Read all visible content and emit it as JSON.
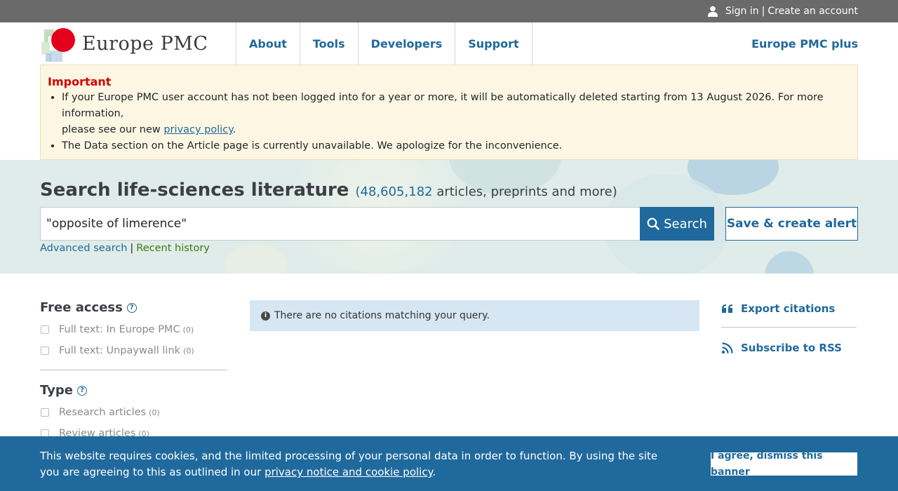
{
  "topbar": {
    "sign_in": "Sign in",
    "separator": "|",
    "create_account": "Create an account"
  },
  "header": {
    "logo_text": "Europe PMC",
    "nav": [
      {
        "label": "About"
      },
      {
        "label": "Tools"
      },
      {
        "label": "Developers"
      },
      {
        "label": "Support"
      }
    ],
    "plus_link": "Europe PMC plus"
  },
  "notice": {
    "heading": "Important",
    "item1_line1": "If your Europe PMC user account has not been logged into for a year or more, it will be automatically deleted starting from 13 August 2026. For more information,",
    "item1_prefix": "please see our new ",
    "item1_link": "privacy policy",
    "item1_suffix": ".",
    "item2": "The Data section on the Article page is currently unavailable. We apologize for the inconvenience."
  },
  "search": {
    "title": "Search life-sciences literature",
    "open_paren": "(",
    "count": "48,605,182",
    "count_suffix": " articles, preprints and more)",
    "query": "\"opposite of limerence\"",
    "button": "Search",
    "alert_button": "Save & create alert",
    "advanced": "Advanced search",
    "sep": "|",
    "history": "Recent history"
  },
  "sidebar": {
    "free_access": {
      "title": "Free access",
      "items": [
        {
          "label": "Full text: In Europe PMC",
          "count": "(0)"
        },
        {
          "label": "Full text: Unpaywall link",
          "count": "(0)"
        }
      ]
    },
    "type": {
      "title": "Type",
      "items": [
        {
          "label": "Research articles",
          "count": "(0)"
        },
        {
          "label": "Review articles",
          "count": "(0)"
        }
      ]
    }
  },
  "results": {
    "message": "There are no citations matching your query."
  },
  "right": {
    "export": "Export citations",
    "rss": "Subscribe to RSS"
  },
  "cookie": {
    "text": "This website requires cookies, and the limited processing of your personal data in order to function. By using the site you are agreeing to this as outlined in our ",
    "link": "privacy notice and cookie policy",
    "suffix": ".",
    "button": "I agree, dismiss this banner"
  },
  "colors": {
    "brand_blue": "#20699c",
    "important_red": "#d70000",
    "history_green": "#3b7a14",
    "notice_bg": "#fdf6e3",
    "message_bg": "#d6e6f3"
  }
}
